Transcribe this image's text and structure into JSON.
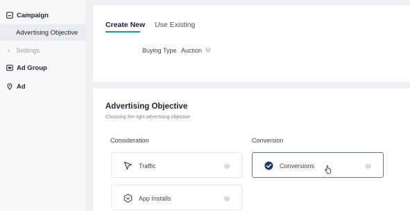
{
  "sidebar": {
    "campaign": "Campaign",
    "advertising_objective": "Advertising Objective",
    "settings": "Settings",
    "ad_group": "Ad Group",
    "ad": "Ad"
  },
  "tabs": {
    "create_new": "Create New",
    "use_existing": "Use Existing"
  },
  "buying": {
    "label": "Buying Type",
    "value": "Auction"
  },
  "objective_section": {
    "title": "Advertising Objective",
    "subtitle": "Choosing the right advertising objective",
    "consideration_heading": "Consideration",
    "conversion_heading": "Conversion",
    "options": {
      "traffic": "Traffic",
      "conversions": "Conversions",
      "app_installs": "App Installs"
    },
    "selected": "Conversions"
  },
  "colors": {
    "accent": "#16a47a",
    "selected_check": "#1e3a5f",
    "background": "#eef0f3"
  }
}
